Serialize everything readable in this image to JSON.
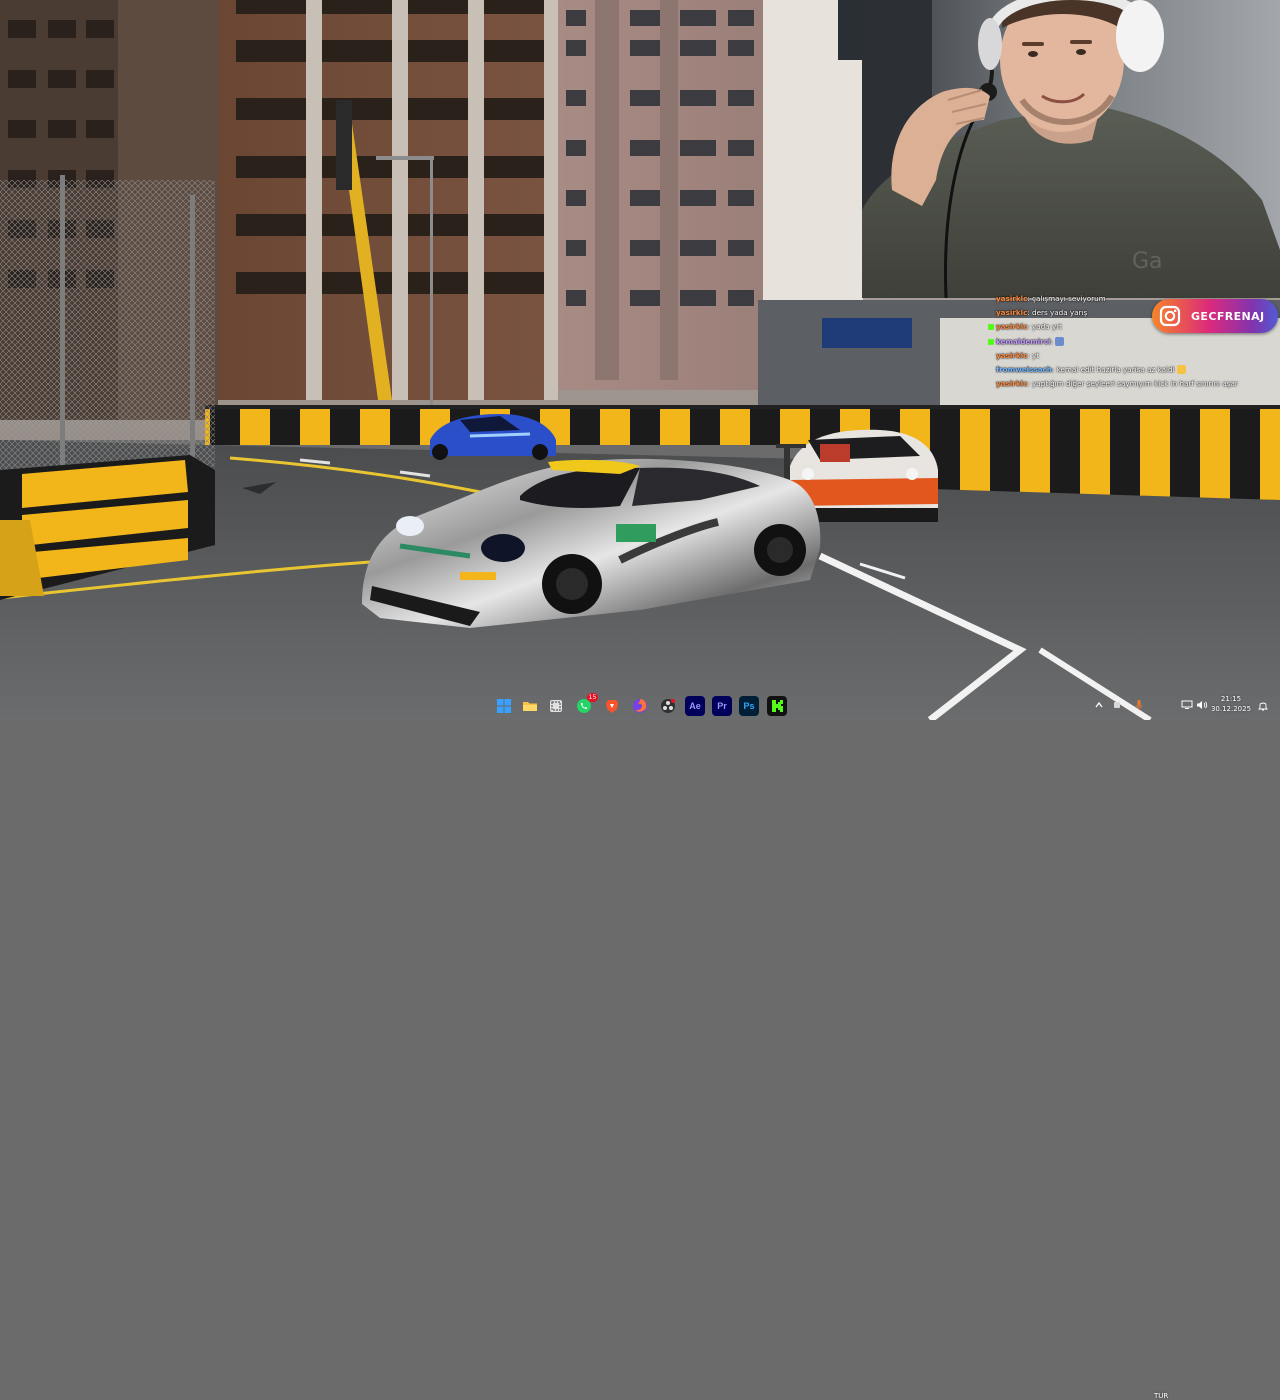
{
  "chat": {
    "messages": [
      {
        "user": "yasirklc",
        "text": ": çalışmayı seviyorum",
        "user_color": "#ff8a3d",
        "badge_color": ""
      },
      {
        "user": "yasirklc",
        "text": ": ders yada yarış",
        "user_color": "#ff8a3d",
        "badge_color": ""
      },
      {
        "user": "yasirklc",
        "text": ": yada yrt",
        "user_color": "#ff8a3d",
        "badge_color": "#53fc18"
      },
      {
        "user": "kemaldemirci",
        "text": ":",
        "user_color": "#c39bff",
        "badge_color": "#53fc18",
        "emote": "frame-emote"
      },
      {
        "user": "yasirklc",
        "text": ": yt",
        "user_color": "#ff8a3d",
        "badge_color": ""
      },
      {
        "user": "fromweissach",
        "text": ": kemal edit hazirla yarisa az kaldi",
        "user_color": "#6fb6ff",
        "badge_color": "",
        "emote": "smile-emote"
      },
      {
        "user": "yasirklc",
        "text": ": yaptığım diğer şeyleeri saymıyım kick in harf sınırını aşar",
        "user_color": "#ff8a3d",
        "badge_color": ""
      }
    ]
  },
  "instagram": {
    "handle": "GECFRENAJ",
    "icon": "instagram-icon"
  },
  "taskbar": {
    "apps": [
      {
        "name": "start",
        "icon": "windows-icon",
        "color": "#3aa0ff"
      },
      {
        "name": "file-explorer",
        "icon": "folder-icon",
        "color": "#f6c342"
      },
      {
        "name": "snipping-tool",
        "icon": "snip-icon",
        "color": "#e0e0e0"
      },
      {
        "name": "whatsapp",
        "icon": "whatsapp-icon",
        "color": "#25d366",
        "badge": "15"
      },
      {
        "name": "brave",
        "icon": "brave-icon",
        "color": "#fb542b"
      },
      {
        "name": "firefox",
        "icon": "firefox-icon",
        "color": "#ff7139"
      },
      {
        "name": "obs",
        "icon": "obs-icon",
        "color": "#302e31"
      },
      {
        "name": "after-effects",
        "icon": "ae-icon",
        "color": "#00005b",
        "label": "Ae",
        "label_color": "#9999ff"
      },
      {
        "name": "premiere",
        "icon": "pr-icon",
        "color": "#00005b",
        "label": "Pr",
        "label_color": "#9999ff"
      },
      {
        "name": "photoshop",
        "icon": "ps-icon",
        "color": "#001e36",
        "label": "Ps",
        "label_color": "#31a8ff"
      },
      {
        "name": "kick",
        "icon": "kick-icon",
        "color": "#111111",
        "accent": "#53fc18"
      }
    ],
    "tray": {
      "language": "TUR",
      "time": "21:15",
      "date": "30.12.2025"
    }
  },
  "colors": {
    "barrier_yellow": "#f2b51a",
    "barrier_black": "#1b1b1b",
    "asphalt": "#5d5f60",
    "building_brown": "#6e4a35"
  }
}
